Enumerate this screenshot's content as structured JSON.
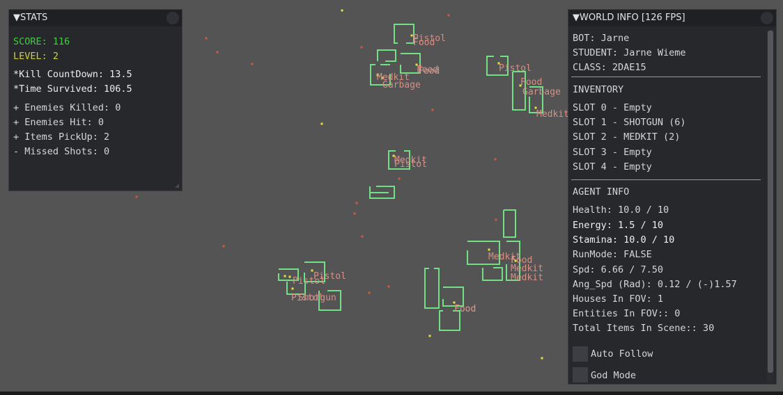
{
  "stats_panel": {
    "title": "STATS",
    "score": "SCORE: 116",
    "level": "LEVEL: 2",
    "kill_countdown": "*Kill CountDown: 13.5",
    "time_survived": "*Time Survived: 106.5",
    "enemies_killed": "+ Enemies Killed: 0",
    "enemies_hit": "+ Enemies Hit: 0",
    "items_pickup": "+ Items PickUp: 2",
    "missed_shots": "- Missed Shots: 0"
  },
  "world_info_panel": {
    "title": "WORLD INFO [126 FPS]",
    "bot": "BOT: Jarne",
    "student": "STUDENT: Jarne Wieme",
    "class": "CLASS: 2DAE15",
    "inventory_header": "INVENTORY",
    "slots": [
      "SLOT 0 - Empty",
      "SLOT 1 - SHOTGUN (6)",
      "SLOT 2 - MEDKIT (2)",
      "SLOT 3 - Empty",
      "SLOT 4 - Empty"
    ],
    "agent_header": "AGENT INFO",
    "health": "Health: 10.0 / 10",
    "energy": "Energy: 1.5 / 10",
    "stamina": "Stamina: 10.0 / 10",
    "run_mode": "RunMode: FALSE",
    "speed": "Spd: 6.66 / 7.50",
    "ang_speed": "Ang_Spd (Rad): 0.12 / (-)1.57",
    "houses_in_fov": "Houses In FOV: 1",
    "entities_in_fov": "Entities In FOV:: 0",
    "total_items": "Total Items In Scene:: 30",
    "auto_follow_label": "Auto Follow",
    "god_mode_label": "God Mode"
  },
  "world_labels": [
    "Pistol",
    "Food",
    "Medkit",
    "Food",
    "Garbage",
    "Food",
    "Pistol",
    "Food",
    "Garbage",
    "Medkit",
    "Medkit",
    "Pistol",
    "Medkit",
    "Food",
    "Medkit",
    "Medkit",
    "Pistol",
    "Pistol",
    "Pistol",
    "Shotgun",
    "Food",
    "Food"
  ],
  "colors": {
    "background": "#545454",
    "panel": "#26282c",
    "house_outline": "#74e085",
    "item_label": "#d88f86",
    "score": "#3fcf3f",
    "level": "#cfcf3f"
  }
}
